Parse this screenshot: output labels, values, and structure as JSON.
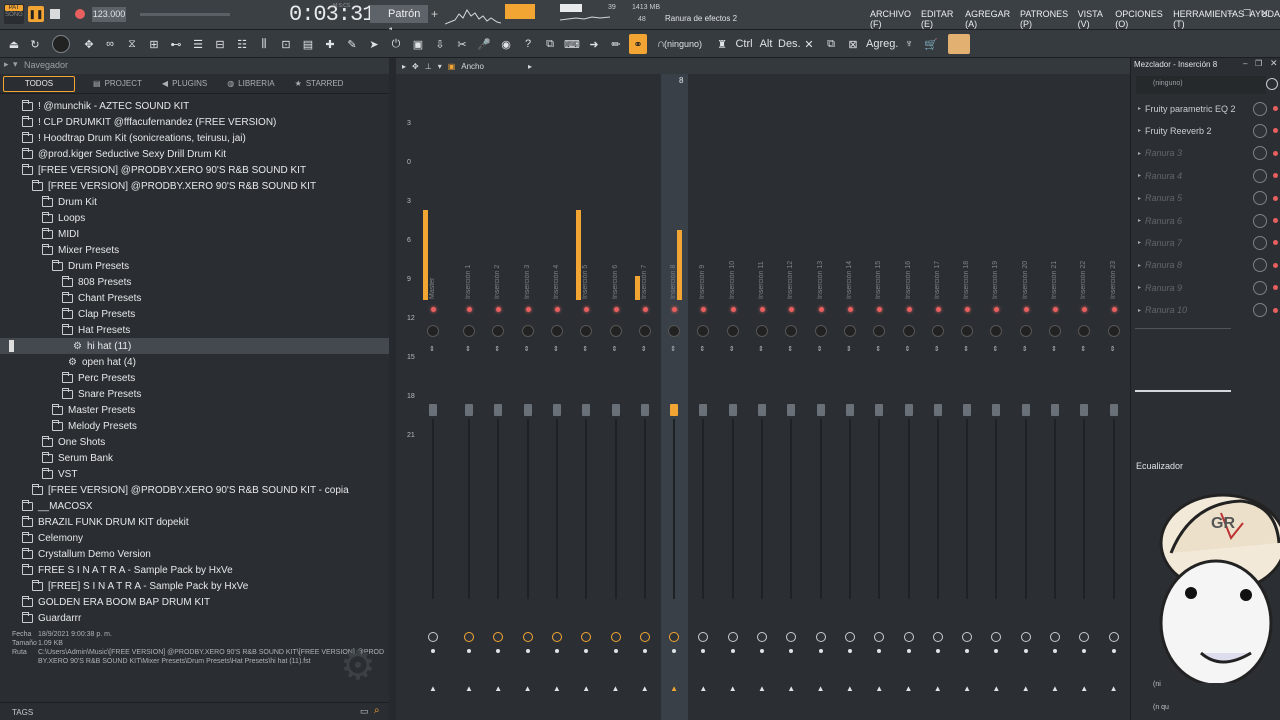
{
  "topbar": {
    "pat_label": "PAT",
    "song_label": "SONG",
    "tempo": "123.000",
    "time": "0:03:31",
    "time_sub": "M:S:CS",
    "pattern": "Patrón 1",
    "cpu": "39",
    "mem": "1413 MB",
    "mem2": "48",
    "hint": "Ranura de efectos 2",
    "menu": [
      "ARCHIVO (F)",
      "EDITAR (E)",
      "AGREGAR (A)",
      "PATRONES (P)",
      "VISTA (V)",
      "OPCIONES (O)",
      "HERRAMIENTAS (T)",
      "AYUDA"
    ]
  },
  "toolbar": {
    "none_label": "(ninguno)",
    "ctrl_label": "Ctrl",
    "alt_label": "Alt",
    "des_label": "Des.",
    "agreg_label": "Agreg."
  },
  "browser": {
    "title": "Navegador",
    "tabs": [
      "TODOS",
      "PROJECT",
      "PLUGINS",
      "LIBRERIA",
      "STARRED"
    ],
    "tree": [
      {
        "label": "! @munchik - AZTEC SOUND KIT",
        "level": 0,
        "type": "folder"
      },
      {
        "label": "! CLP DRUMKIT @fffacufernandez (FREE VERSION)",
        "level": 0,
        "type": "folder"
      },
      {
        "label": "! Hoodtrap Drum Kit (sonicreations, teirusu, jai)",
        "level": 0,
        "type": "folder"
      },
      {
        "label": "@prod.kiger Seductive Sexy Drill Drum Kit",
        "level": 0,
        "type": "folder"
      },
      {
        "label": "[FREE VERSION] @PRODBY.XERO 90'S R&B SOUND KIT",
        "level": 0,
        "type": "folder"
      },
      {
        "label": "[FREE VERSION] @PRODBY.XERO 90'S R&B SOUND KIT",
        "level": 1,
        "type": "folder"
      },
      {
        "label": "Drum Kit",
        "level": 2,
        "type": "folder"
      },
      {
        "label": "Loops",
        "level": 2,
        "type": "folder"
      },
      {
        "label": "MIDI",
        "level": 2,
        "type": "folder"
      },
      {
        "label": "Mixer Presets",
        "level": 2,
        "type": "folder"
      },
      {
        "label": "Drum Presets",
        "level": 3,
        "type": "folder"
      },
      {
        "label": "808 Presets",
        "level": 4,
        "type": "folder"
      },
      {
        "label": "Chant Presets",
        "level": 4,
        "type": "folder"
      },
      {
        "label": "Clap Presets",
        "level": 4,
        "type": "folder"
      },
      {
        "label": "Hat Presets",
        "level": 4,
        "type": "folder"
      },
      {
        "label": "hi hat (11)",
        "level": 5,
        "type": "preset",
        "selected": true
      },
      {
        "label": "open hat (4)",
        "level": 4.5,
        "type": "preset"
      },
      {
        "label": "Perc Presets",
        "level": 4,
        "type": "folder"
      },
      {
        "label": "Snare Presets",
        "level": 4,
        "type": "folder"
      },
      {
        "label": "Master Presets",
        "level": 3,
        "type": "folder"
      },
      {
        "label": "Melody Presets",
        "level": 3,
        "type": "folder"
      },
      {
        "label": "One Shots",
        "level": 2,
        "type": "folder"
      },
      {
        "label": "Serum Bank",
        "level": 2,
        "type": "folder"
      },
      {
        "label": "VST",
        "level": 2,
        "type": "folder"
      },
      {
        "label": "[FREE VERSION] @PRODBY.XERO 90'S R&B SOUND KIT - copia",
        "level": 1,
        "type": "folder"
      },
      {
        "label": "__MACOSX",
        "level": 0,
        "type": "folder"
      },
      {
        "label": "BRAZIL FUNK DRUM KIT dopekit",
        "level": 0,
        "type": "folder"
      },
      {
        "label": "Celemony",
        "level": 0,
        "type": "folder"
      },
      {
        "label": "Crystallum Demo Version",
        "level": 0,
        "type": "folder"
      },
      {
        "label": "FREE S I N A T R A - Sample Pack by HxVe",
        "level": 0,
        "type": "folder"
      },
      {
        "label": "[FREE] S I N A T R A - Sample Pack by HxVe",
        "level": 1,
        "type": "folder"
      },
      {
        "label": "GOLDEN ERA BOOM BAP DRUM KIT",
        "level": 0,
        "type": "folder"
      },
      {
        "label": "Guardarrr",
        "level": 0,
        "type": "folder"
      }
    ],
    "info": {
      "fecha_label": "Fecha",
      "fecha": "18/9/2021 9:00:38 p. m.",
      "tamano_label": "Tamaño",
      "tamano": "1.09 KB",
      "ruta_label": "Ruta",
      "ruta": "C:\\Users\\Admin\\Music\\[FREE VERSION] @PRODBY.XERO 90'S R&B SOUND KIT\\[FREE VERSION] @PRODBY.XERO 90'S R&B SOUND KIT\\Mixer Presets\\Drum Presets\\Hat Presets\\hi hat (11).fst"
    },
    "tags_label": "TAGS"
  },
  "mixer": {
    "header_label": "Ancho",
    "selected_number": "8",
    "scale": [
      "3",
      "0",
      "3",
      "6",
      "9",
      "12",
      "15",
      "18",
      "21"
    ],
    "strips": [
      "Master",
      "Inserción 1",
      "Inserción 2",
      "Inserción 3",
      "Inserción 4",
      "Inserción 5",
      "Inserción 6",
      "Inserción 7",
      "Inserción 8",
      "Inserción 9",
      "Inserción 10",
      "Inserción 11",
      "Inserción 12",
      "Inserción 13",
      "Inserción 14",
      "Inserción 15",
      "Inserción 16",
      "Inserción 17",
      "Inserción 18",
      "Inserción 19",
      "Inserción 20",
      "Inserción 21",
      "Inserción 22",
      "Inserción 23"
    ],
    "meter_levels": [
      0.45,
      0.0,
      0.0,
      0.0,
      0.0,
      0.45,
      0.0,
      0.12,
      0.35,
      0,
      0,
      0,
      0,
      0,
      0,
      0,
      0,
      0,
      0,
      0,
      0,
      0,
      0,
      0
    ]
  },
  "side": {
    "title": "Mezclador - Inserción 8",
    "preset": "(ninguno)",
    "slots": [
      "Fruity parametric EQ 2",
      "Fruity Reeverb 2",
      "Ranura 3",
      "Ranura 4",
      "Ranura 5",
      "Ranura 6",
      "Ranura 7",
      "Ranura 8",
      "Ranura 9",
      "Ranura 10"
    ],
    "eq_label": "Ecualizador",
    "bottom1": "(ni",
    "bottom2": "(n qu",
    "accent": "#f3a533"
  }
}
